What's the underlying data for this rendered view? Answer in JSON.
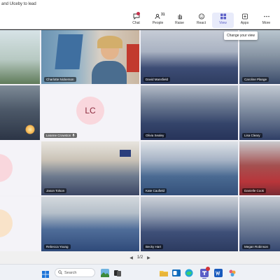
{
  "window": {
    "title": "and Ulceby to lead"
  },
  "toolbar": {
    "buttons": [
      {
        "label": "Chat",
        "icon": "chat-icon"
      },
      {
        "label": "People",
        "icon": "people-icon",
        "count": "31"
      },
      {
        "label": "Raise",
        "icon": "raise-hand-icon"
      },
      {
        "label": "React",
        "icon": "react-icon"
      },
      {
        "label": "View",
        "icon": "view-grid-icon",
        "active": true
      },
      {
        "label": "Apps",
        "icon": "apps-icon"
      },
      {
        "label": "More",
        "icon": "more-icon"
      }
    ],
    "tooltip": "Change your view"
  },
  "grid": {
    "tiles": [
      {
        "name": ""
      },
      {
        "name": "Charlotte Nickerson"
      },
      {
        "name": "David Mansfield"
      },
      {
        "name": "Caroline Plange"
      },
      {
        "name": ""
      },
      {
        "name": "Leanne Crowston",
        "initials": "LC"
      },
      {
        "name": "Olivia Sealey"
      },
      {
        "name": "Lisa Cleary"
      },
      {
        "name": ""
      },
      {
        "name": "Jason Tolson"
      },
      {
        "name": "Kate Caufield"
      },
      {
        "name": "Danielle Cook"
      },
      {
        "name": ""
      },
      {
        "name": "Rebecca Young"
      },
      {
        "name": "Becky Hart"
      },
      {
        "name": "Megan Robinson"
      }
    ]
  },
  "pager": {
    "label": "1/2"
  },
  "taskbar": {
    "search_label": "Search"
  },
  "colors": {
    "accent": "#5b5fc7",
    "notification": "#c4314b"
  }
}
